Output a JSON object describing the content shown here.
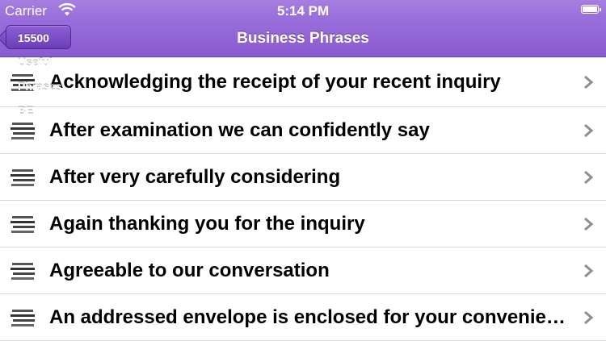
{
  "status_bar": {
    "carrier": "Carrier",
    "time": "5:14 PM"
  },
  "nav": {
    "back_label": "15500 Useful Phrases BE",
    "title": "Business Phrases"
  },
  "colors": {
    "nav_bar": "#9a6fdc",
    "back_button": "#6c3fb8",
    "row_separator": "#d9d9d9",
    "chevron": "#8e8e93"
  },
  "rows": [
    {
      "label": "Acknowledging the receipt of your recent inquiry",
      "icon": "list-lines-icon"
    },
    {
      "label": "After examination we can confidently say",
      "icon": "list-lines-icon"
    },
    {
      "label": "After very carefully considering",
      "icon": "list-lines-icon"
    },
    {
      "label": "Again thanking you for the inquiry",
      "icon": "list-lines-icon"
    },
    {
      "label": "Agreeable to our conversation",
      "icon": "list-lines-icon"
    },
    {
      "label": "An addressed envelope is enclosed for your convenience",
      "icon": "list-lines-icon"
    }
  ]
}
